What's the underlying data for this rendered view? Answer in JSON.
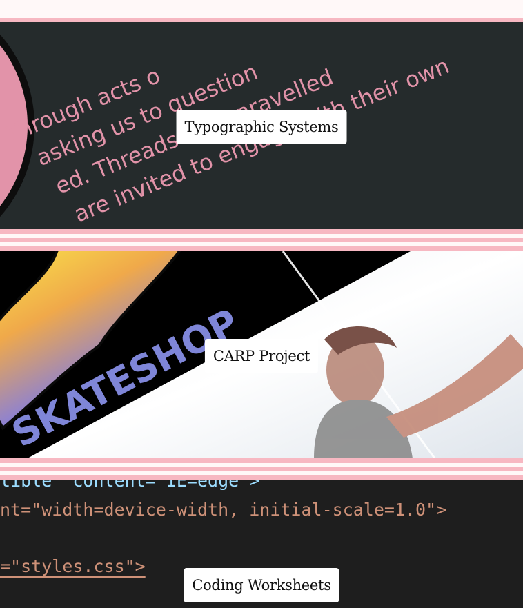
{
  "projects": [
    {
      "label": "Typographic Systems",
      "thumbnail_lines": [
        "Through acts o",
        "asking us to question",
        "ed. Threads are unravelled",
        "are invited to engage with their own"
      ]
    },
    {
      "label": "CARP Project",
      "thumbnail_lines": [
        "SKATESHOP"
      ]
    },
    {
      "label": "Coding Worksheets",
      "thumbnail_lines": [
        "tible\" content=\"IE=edge\">",
        "nt=\"width=device-width, initial-scale=1.0\">",
        "=\"styles.css\">"
      ]
    }
  ],
  "colors": {
    "accent_pink": "#f7b8c2",
    "tile1_bg": "#252b2c",
    "tile1_text": "#e293a9",
    "code_bg": "#1e1e1e",
    "code_attr": "#9cdcfe",
    "code_string": "#ce9178"
  }
}
